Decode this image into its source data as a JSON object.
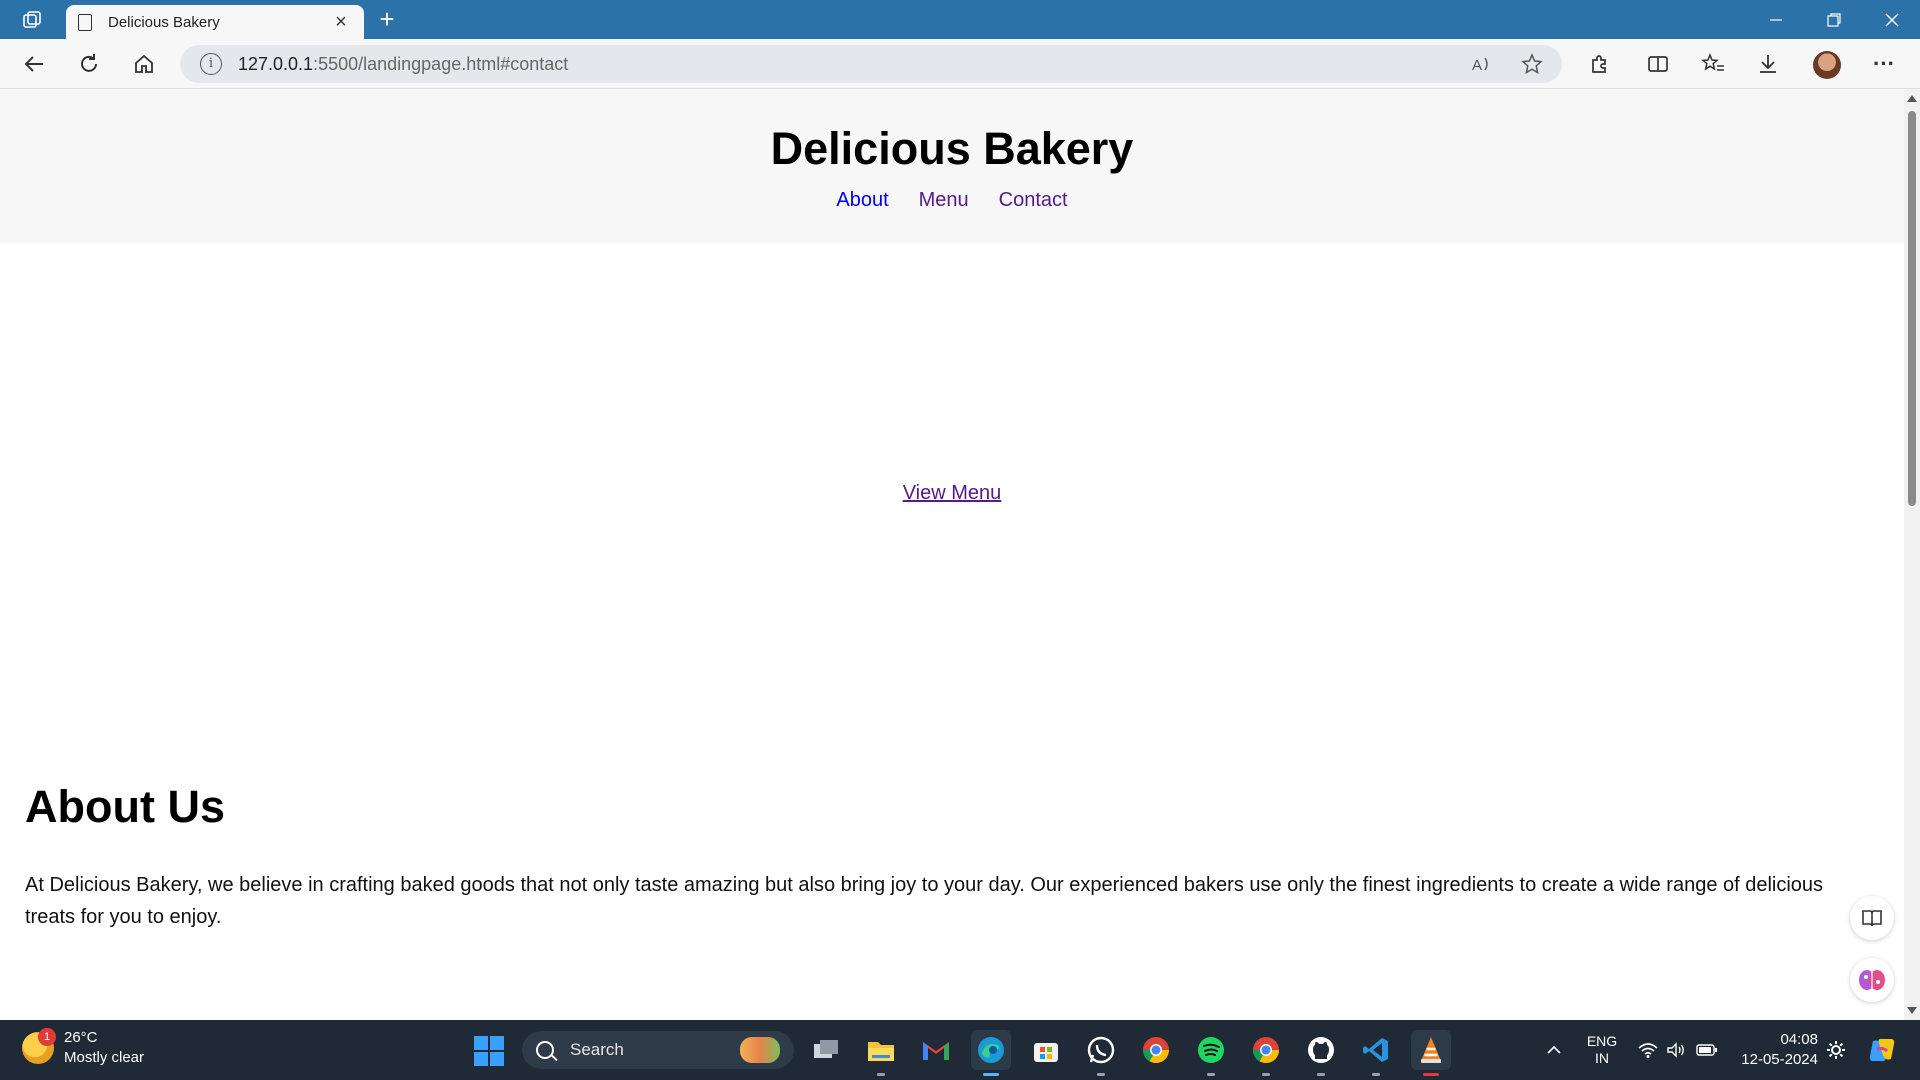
{
  "browser": {
    "tab_title": "Delicious Bakery",
    "url_host": "127.0.0.1",
    "url_rest": ":5500/landingpage.html#contact",
    "new_tab_label": "+",
    "close_tab_label": "×",
    "buttons": {
      "back": "back-arrow",
      "reload": "reload",
      "home": "home",
      "read_aloud": "read-aloud",
      "favorite": "star",
      "extensions": "puzzle",
      "split": "split-screen",
      "favorites": "favorites",
      "downloads": "download",
      "more": "···"
    }
  },
  "site": {
    "title": "Delicious Bakery",
    "nav": [
      "About",
      "Menu",
      "Contact"
    ],
    "hero_link": "View Menu",
    "about_heading": "About Us",
    "about_text": "At Delicious Bakery, we believe in crafting baked goods that not only taste amazing but also bring joy to your day. Our experienced bakers use only the finest ingredients to create a wide range of delicious treats for you to enjoy."
  },
  "taskbar": {
    "weather_badge": "1",
    "temperature": "26°C",
    "condition": "Mostly clear",
    "search_placeholder": "Search",
    "language_top": "ENG",
    "language_bottom": "IN",
    "time": "04:08",
    "date": "12-05-2024",
    "apps": [
      "task-view",
      "file-explorer",
      "gmail",
      "edge",
      "microsoft-store",
      "whatsapp",
      "chrome",
      "spotify",
      "chrome-profile",
      "github",
      "vscode",
      "vlc"
    ]
  },
  "colors": {
    "titlebar": "#2a72a8",
    "taskbar": "#1f2a36",
    "link_unvisited": "#0000ee",
    "link_visited": "#551a8b"
  }
}
